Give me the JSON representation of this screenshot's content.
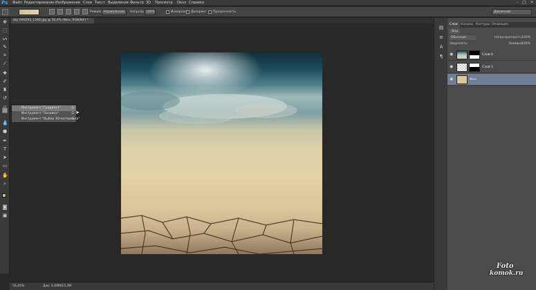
{
  "app": {
    "logo": "Ps"
  },
  "menu": [
    "Файл",
    "Редактирование",
    "Изображение",
    "Слои",
    "Текст",
    "Выделение",
    "Фильтр",
    "3D",
    "Просмотр",
    "Окно",
    "Справка"
  ],
  "window_controls": {
    "minimize": "–",
    "maximize": "□",
    "close": "×"
  },
  "options": {
    "mode_label": "Режим:",
    "mode_value": "Нормальный",
    "opacity_label": "Непрозр.:",
    "opacity_value": "100%",
    "inverse_label": "Инверсия",
    "dither_label": "Дизеринг",
    "transparency_label": "Прозрачность",
    "workspace_value": "Движение",
    "gradient_color": "#d4bd93"
  },
  "document": {
    "tab_label": "sky 690293_1280.jpg @ 56,4% (Фон, RGB/8#) *"
  },
  "tools": [
    "move-icon",
    "marquee-icon",
    "lasso-icon",
    "quick-select-icon",
    "crop-icon",
    "eyedropper-icon",
    "healing-icon",
    "brush-icon",
    "clone-stamp-icon",
    "history-brush-icon",
    "eraser-icon",
    "gradient-icon",
    "blur-icon",
    "dodge-icon",
    "pen-icon",
    "type-icon",
    "path-select-icon",
    "shape-icon",
    "hand-icon",
    "zoom-icon"
  ],
  "flyout": {
    "items": [
      {
        "label": "Инструмент \"Градиент\"",
        "key": "G"
      },
      {
        "label": "Инструмент \"Заливка\"",
        "key": "G"
      },
      {
        "label": "Инструмент \"Выбор 3D-материала\"",
        "key": "G"
      }
    ]
  },
  "status": {
    "zoom": "56,45%",
    "doc_size": "Док: 4,69M/15,3M"
  },
  "layers_panel": {
    "tabs": [
      "Слои",
      "Каналы",
      "Контуры",
      "Операции"
    ],
    "kind_label": "Вид",
    "blend_mode": "Обычные",
    "opacity_label": "Непрозрачность:",
    "opacity_value": "100%",
    "lock_label": "Закрепить:",
    "fill_label": "Заливка:",
    "fill_value": "100%",
    "layers": [
      {
        "name": "Слой 0",
        "selected": false
      },
      {
        "name": "Слой 1",
        "selected": false
      },
      {
        "name": "Фон",
        "selected": true
      }
    ]
  },
  "watermark": {
    "line1": "Foto",
    "line2": "komok.ru"
  }
}
